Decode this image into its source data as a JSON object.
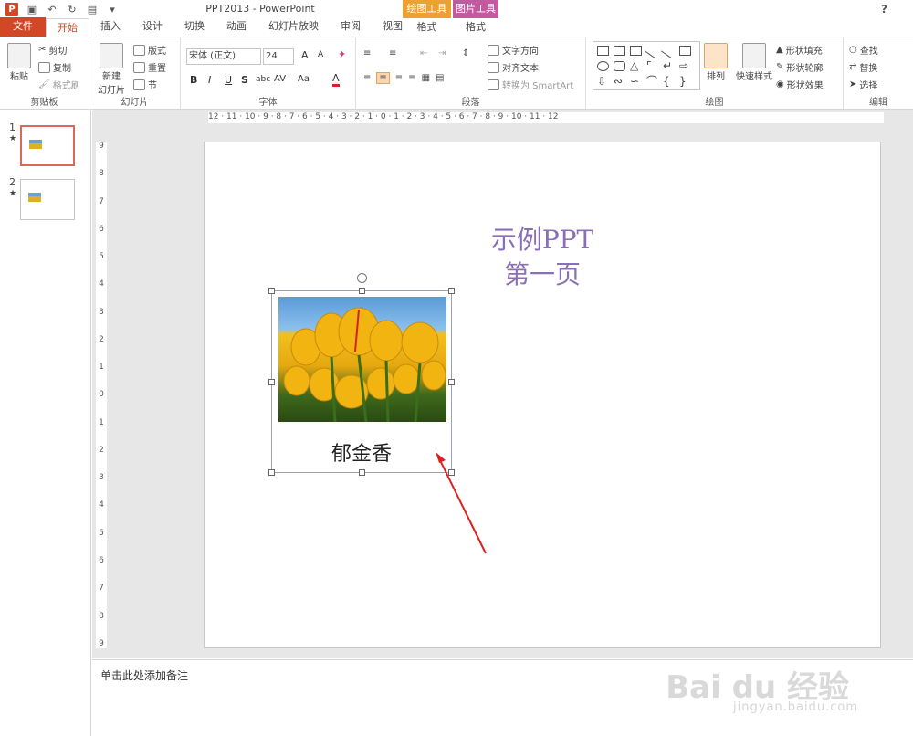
{
  "app": {
    "window_title": "PPT2013 - PowerPoint",
    "help_label": "?"
  },
  "context_groups": [
    {
      "name": "绘图工具",
      "tab": "格式",
      "color": "#f0a030"
    },
    {
      "name": "图片工具",
      "tab": "格式",
      "color": "#c35aa0"
    }
  ],
  "tabs": [
    "文件",
    "开始",
    "插入",
    "设计",
    "切换",
    "动画",
    "幻灯片放映",
    "审阅",
    "视图"
  ],
  "ribbon": {
    "clipboard": {
      "label": "剪贴板",
      "paste": "粘贴",
      "cut": "剪切",
      "copy": "复制",
      "format_painter": "格式刷"
    },
    "slides": {
      "label": "幻灯片",
      "new_slide_line1": "新建",
      "new_slide_line2": "幻灯片",
      "layout": "版式",
      "reset": "重置",
      "section": "节"
    },
    "font": {
      "label": "字体",
      "font_name": "宋体 (正文)",
      "font_size": "24",
      "grow": "A",
      "shrink": "A",
      "bold": "B",
      "italic": "I",
      "underline": "U",
      "shadow": "S",
      "strike": "abc",
      "spacing": "AV",
      "case": "Aa",
      "color": "A"
    },
    "paragraph": {
      "label": "段落",
      "text_direction": "文字方向",
      "align_text": "对齐文本",
      "convert_smartart": "转换为 SmartArt"
    },
    "drawing": {
      "label": "绘图",
      "arrange": "排列",
      "quick_styles": "快速样式",
      "shape_fill": "形状填充",
      "shape_outline": "形状轮廓",
      "shape_effects": "形状效果"
    },
    "editing": {
      "label": "编辑",
      "find": "查找",
      "replace": "替换",
      "select": "选择"
    }
  },
  "thumbnails": [
    {
      "num": "1",
      "star": "★"
    },
    {
      "num": "2",
      "star": "★"
    }
  ],
  "ruler": {
    "h_ticks": "12 · 11 · 10 · 9 · 8 · 7 · 6 · 5 · 4 · 3 · 2 · 1 · 0 · 1 · 2 · 3 · 4 · 5 · 6 · 7 · 8 · 9 · 10 · 11 · 12",
    "v_ticks": [
      "9",
      "8",
      "7",
      "6",
      "5",
      "4",
      "3",
      "2",
      "1",
      "0",
      "1",
      "2",
      "3",
      "4",
      "5",
      "6",
      "7",
      "8",
      "9"
    ]
  },
  "slide": {
    "title_line1": "示例PPT",
    "title_line2": "第一页",
    "caption": "郁金香"
  },
  "notes_placeholder": "单击此处添加备注",
  "watermark": {
    "brand": "Bai du 经验",
    "url": "jingyan.baidu.com"
  },
  "colors": {
    "accent": "#d24726",
    "title_text": "#8a6fb8",
    "arrow": "#e02020"
  }
}
